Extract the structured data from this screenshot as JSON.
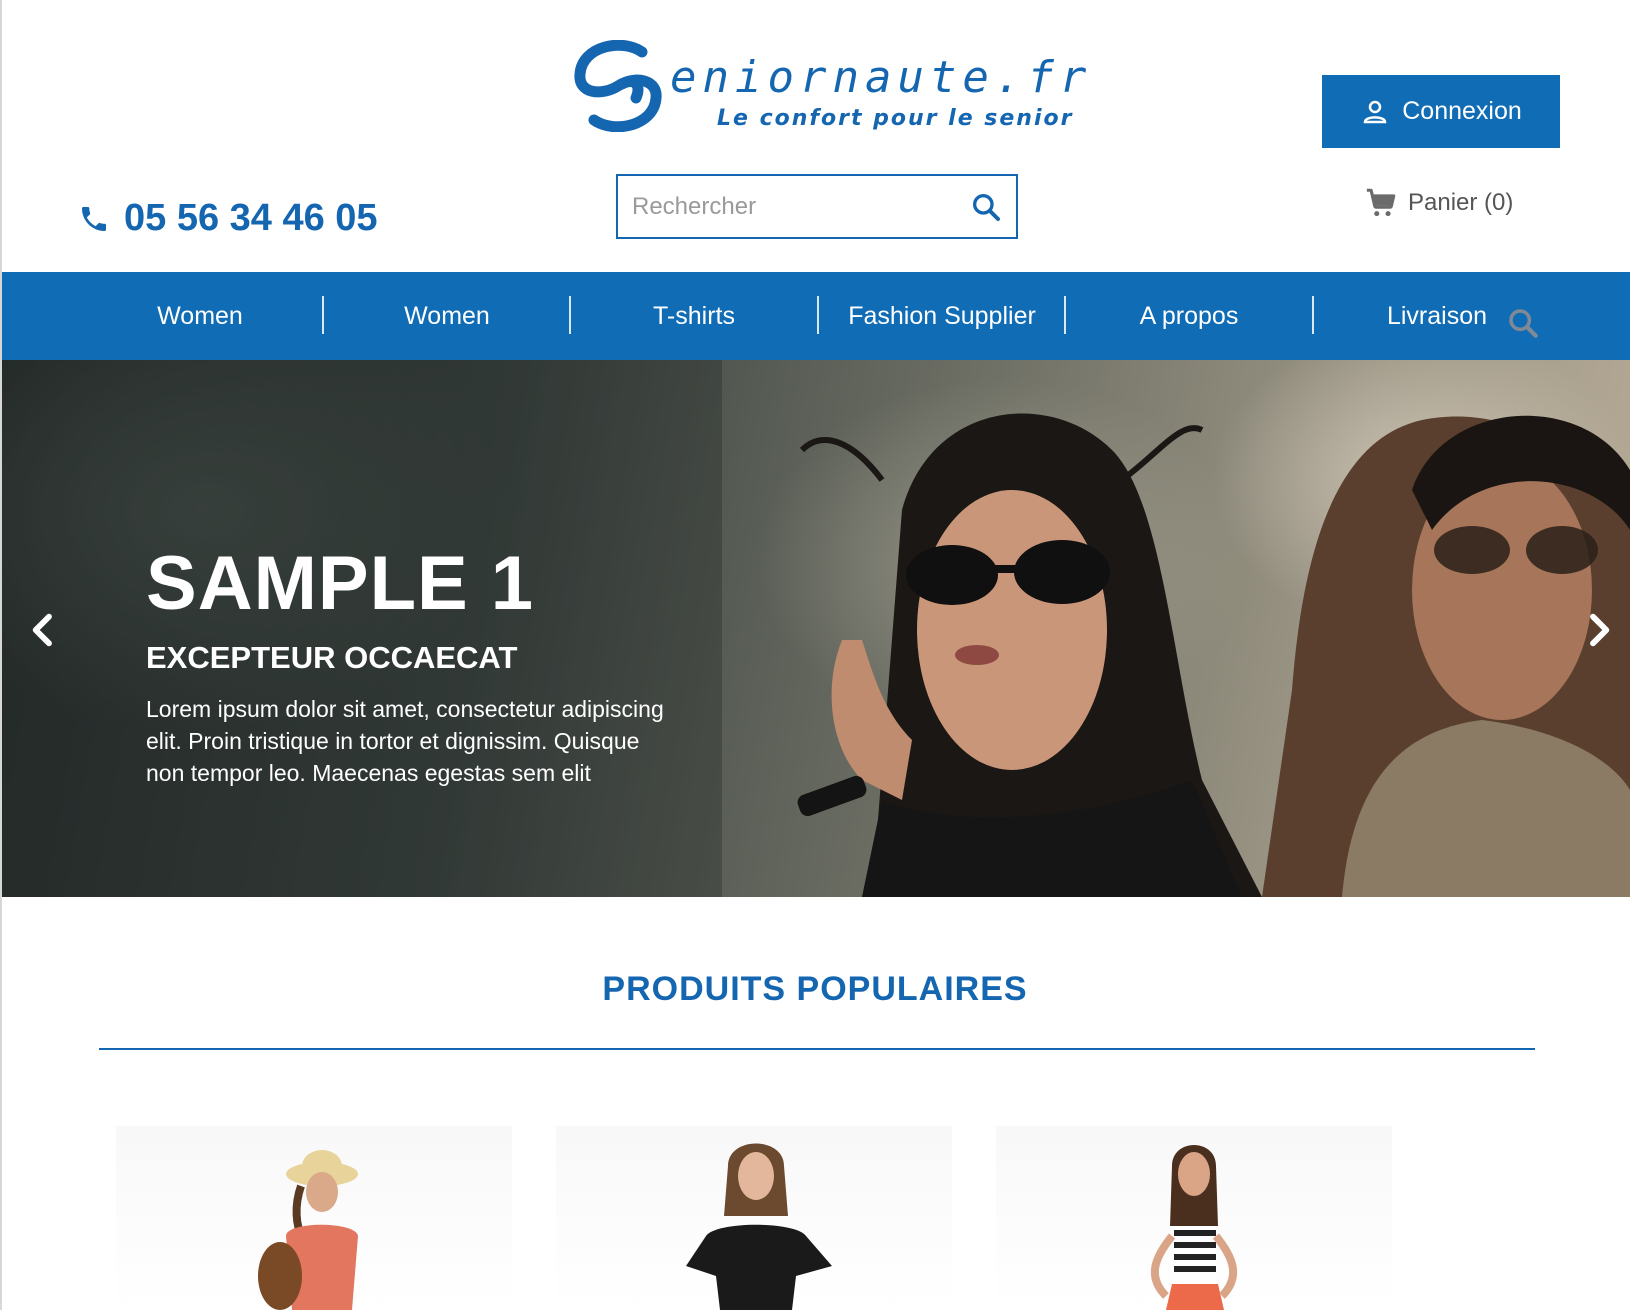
{
  "brand": {
    "logo_text": "eniornaute.fr",
    "tagline": "Le confort pour le senior"
  },
  "header": {
    "login_label": "Connexion",
    "phone": "05 56 34 46 05",
    "search_placeholder": "Rechercher",
    "cart_label": "Panier (0)"
  },
  "nav": {
    "items": [
      {
        "label": "Women"
      },
      {
        "label": "Women"
      },
      {
        "label": "T-shirts"
      },
      {
        "label": "Fashion Supplier"
      },
      {
        "label": "A propos"
      },
      {
        "label": "Livraison"
      }
    ]
  },
  "hero": {
    "title": "SAMPLE 1",
    "subtitle": "EXCEPTEUR OCCAECAT",
    "text": "Lorem ipsum dolor sit amet, consectetur adipiscing elit. Proin tristique in tortor et dignissim. Quisque non tempor leo. Maecenas egestas sem elit"
  },
  "products_section": {
    "title": "PRODUITS POPULAIRES"
  },
  "colors": {
    "brand_blue": "#0f6cb5",
    "text_blue": "#1566b0"
  },
  "icons": [
    "user-icon",
    "phone-icon",
    "search-icon",
    "cart-icon",
    "chevron-left-icon",
    "chevron-right-icon"
  ]
}
